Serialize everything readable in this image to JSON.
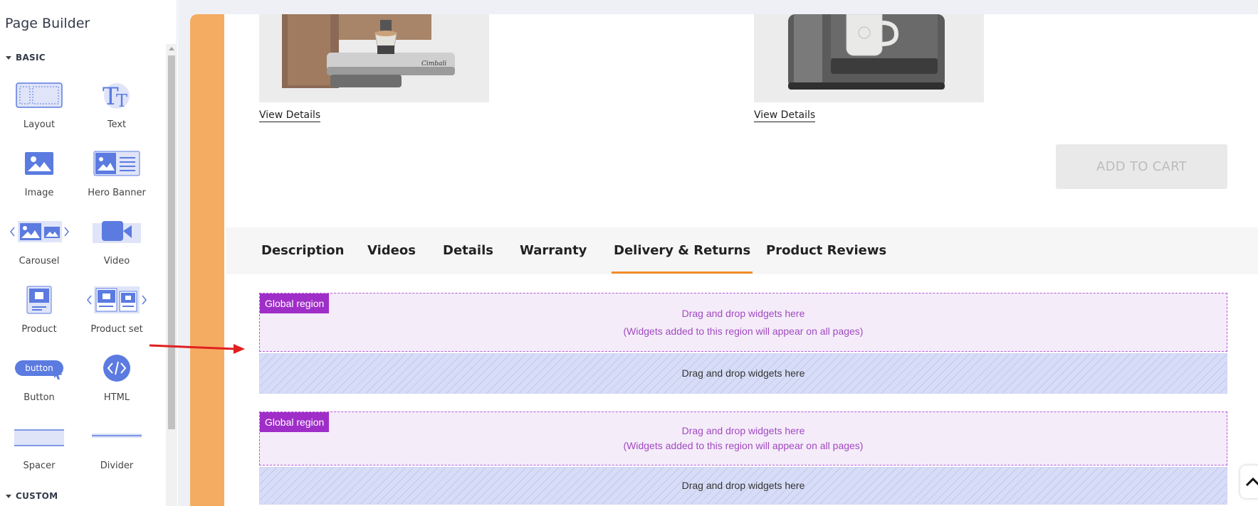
{
  "sidebar": {
    "title": "Page Builder",
    "section_basic": "BASIC",
    "section_custom": "CUSTOM",
    "widgets": [
      {
        "label": "Layout",
        "icon": "layout-icon"
      },
      {
        "label": "Text",
        "icon": "text-icon"
      },
      {
        "label": "Image",
        "icon": "image-icon"
      },
      {
        "label": "Hero Banner",
        "icon": "hero-banner-icon"
      },
      {
        "label": "Carousel",
        "icon": "carousel-icon"
      },
      {
        "label": "Video",
        "icon": "video-icon"
      },
      {
        "label": "Product",
        "icon": "product-icon"
      },
      {
        "label": "Product set",
        "icon": "product-set-icon"
      },
      {
        "label": "Button",
        "icon": "button-icon",
        "icon_text": "button"
      },
      {
        "label": "HTML",
        "icon": "html-icon"
      },
      {
        "label": "Spacer",
        "icon": "spacer-icon"
      },
      {
        "label": "Divider",
        "icon": "divider-icon"
      }
    ]
  },
  "products": [
    {
      "link": "View Details"
    },
    {
      "link": "View Details"
    }
  ],
  "add_to_cart": "ADD TO CART",
  "tabs": [
    "Description",
    "Videos",
    "Details",
    "Warranty",
    "Delivery & Returns",
    "Product Reviews"
  ],
  "active_tab": "Delivery & Returns",
  "regions": [
    {
      "badge": "Global region",
      "line1": "Drag and drop widgets here",
      "line2": "(Widgets added to this region will appear on all pages)",
      "drop": "Drag and drop widgets here"
    },
    {
      "badge": "Global region",
      "line1": "Drag and drop widgets here",
      "line2": "(Widgets added to this region will appear on all pages)",
      "drop": "Drag and drop widgets here"
    }
  ],
  "colors": {
    "accent_orange": "#f4ac62",
    "tab_underline": "#f28c28",
    "global_badge": "#9f2ec8",
    "icon_blue": "#5b7be0"
  }
}
